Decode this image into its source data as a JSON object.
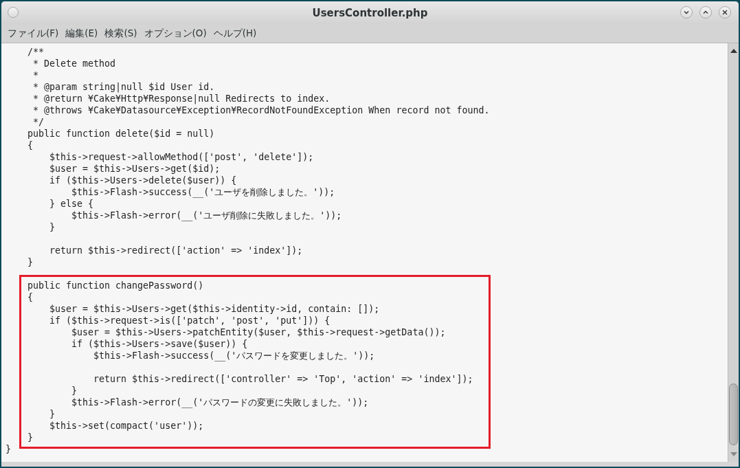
{
  "window": {
    "title": "UsersController.php"
  },
  "menu": [
    {
      "label": "ファイル(F)"
    },
    {
      "label": "編集(E)"
    },
    {
      "label": "検索(S)"
    },
    {
      "label": "オプション(O)"
    },
    {
      "label": "ヘルプ(H)"
    }
  ],
  "editor": {
    "blocks": [
      {
        "highlighted": false,
        "lines": [
          {
            "text": "    /**"
          },
          {
            "text": "     * Delete method"
          },
          {
            "text": "     *"
          },
          {
            "text": "     * @param string|null $id User id."
          },
          {
            "text": "     * @return ¥Cake¥Http¥Response|null Redirects to index."
          },
          {
            "text": "     * @throws ¥Cake¥Datasource¥Exception¥RecordNotFoundException When record not found."
          },
          {
            "text": "     */"
          },
          {
            "text": "    public function delete($id = null)"
          },
          {
            "text": "    {"
          },
          {
            "text": "        $this->request->allowMethod(['post', 'delete']);"
          },
          {
            "text": "        $user = $this->Users->get($id);"
          },
          {
            "text": "        if ($this->Users->delete($user)) {"
          },
          {
            "text": "            $this->Flash->success(__('ユーザを削除しました。'));"
          },
          {
            "text": "        } else {"
          },
          {
            "text": "            $this->Flash->error(__('ユーザ削除に失敗しました。'));"
          },
          {
            "text": "        }",
            "gap_after": true
          },
          {
            "text": "        return $this->redirect(['action' => 'index']);"
          },
          {
            "text": "    }",
            "gap_after": true
          }
        ]
      },
      {
        "highlighted": true,
        "lines": [
          {
            "text": "public function changePassword()"
          },
          {
            "text": "{"
          },
          {
            "text": "    $user = $this->Users->get($this->identity->id, contain: []);"
          },
          {
            "text": "    if ($this->request->is(['patch', 'post', 'put'])) {"
          },
          {
            "text": "        $user = $this->Users->patchEntity($user, $this->request->getData());"
          },
          {
            "text": "        if ($this->Users->save($user)) {"
          },
          {
            "text": "            $this->Flash->success(__('パスワードを変更しました。'));",
            "gap_after": true
          },
          {
            "text": "            return $this->redirect(['controller' => 'Top', 'action' => 'index']);"
          },
          {
            "text": "        }"
          },
          {
            "text": "        $this->Flash->error(__('パスワードの変更に失敗しました。'));"
          },
          {
            "text": "    }"
          },
          {
            "text": "    $this->set(compact('user'));"
          },
          {
            "text": "}"
          }
        ]
      },
      {
        "highlighted": false,
        "lines": [
          {
            "text": "}"
          }
        ]
      }
    ]
  }
}
